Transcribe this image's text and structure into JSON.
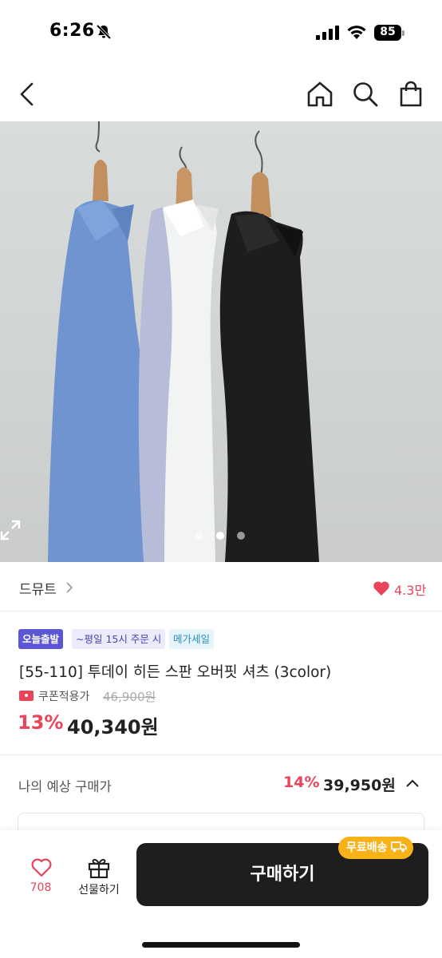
{
  "status_bar": {
    "time": "6:26",
    "battery": "85",
    "icons": [
      "bell-slash-icon",
      "cellular-signal-icon",
      "wifi-icon",
      "battery-icon"
    ]
  },
  "nav": {
    "icons": [
      "back-chevron-icon",
      "home-icon",
      "search-icon",
      "shopping-bag-icon"
    ]
  },
  "gallery": {
    "image": "three button-up shirts (blue, white, black) on wooden hangers",
    "page_count": 3,
    "active_index": 1,
    "expand_icon": "expand-icon"
  },
  "brand": {
    "name": "드뮤트",
    "likes": "4.3만"
  },
  "product": {
    "badges": {
      "today": "오늘출발",
      "weekday": "~평일 15시 주문 시",
      "mega": "메가세일"
    },
    "title": "[55-110] 투데이 히든 스판 오버핏 셔츠 (3color)",
    "coupon_label": "쿠폰적용가",
    "original_price": "46,900원",
    "discount_rate": "13%",
    "sale_price": "40,340원"
  },
  "expected": {
    "label": "나의 예상 구매가",
    "rate": "14%",
    "price": "39,950원"
  },
  "bottom_bar": {
    "wish_count": "708",
    "gift_label": "선물하기",
    "buy_label": "구매하기",
    "free_shipping": "무료배송"
  },
  "colors": {
    "accent_red": "#e8445a",
    "badge_purple": "#5b56d6",
    "buy_button": "#1e1e1e",
    "shipping_yellow": "#f7b21a"
  }
}
